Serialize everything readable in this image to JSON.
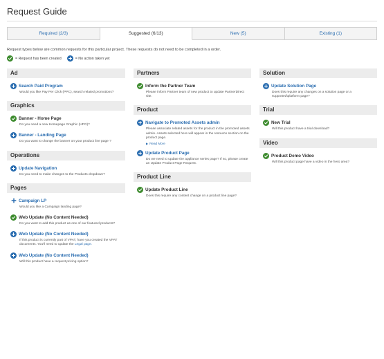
{
  "page": {
    "title": "Request Guide"
  },
  "tabs": [
    {
      "label": "Required (2/3)"
    },
    {
      "label": "Suggested (6/13)"
    },
    {
      "label": "New (5)"
    },
    {
      "label": "Existing (1)"
    }
  ],
  "intro": "Request types below are common requests for this particular project. These requests do not need to be completed in a order.",
  "legend": {
    "created": "= Request has been created",
    "no_action": "= No action taken yet"
  },
  "colors": {
    "link": "#2a6db0",
    "check": "#3d8b2e",
    "section_bg": "#ececec"
  },
  "columns": {
    "left": {
      "sections": [
        {
          "title": "Ad",
          "items": [
            {
              "title": "Search Paid Program",
              "desc": "Would you like Pay Per Click (PPC), search related promotions?",
              "icon": "plus-circle-icon"
            }
          ]
        },
        {
          "title": "Graphics",
          "items": [
            {
              "title": "Banner - Home Page",
              "desc": "Do you need a new Homepage Graphic (HPG)?",
              "icon": "check-circle-icon"
            },
            {
              "title": "Banner - Landing Page",
              "desc": "Do you want to change the banner on your product line page ?",
              "icon": "plus-circle-icon"
            }
          ]
        },
        {
          "title": "Operations",
          "items": [
            {
              "title": "Update Navigation",
              "desc": "Do you need to make changes to the Products dropdown?",
              "icon": "plus-circle-icon"
            }
          ]
        },
        {
          "title": "Pages",
          "items": [
            {
              "title": "Campaign LP",
              "desc": "Would you like a Campaign landing page?",
              "icon": "plus-icon"
            },
            {
              "title": "Web Update (No Content Needed)",
              "desc": "Do you want to add this product as one of our featured products?",
              "icon": "check-circle-icon"
            },
            {
              "title": "Web Update (No Content Needed)",
              "desc": "If this product is currently part of VPAT, have you created the VPAT documents. You'll need to update the ",
              "desc_link": "Legal page.",
              "icon": "plus-circle-icon"
            },
            {
              "title": "Web Update (No Content Needed)",
              "desc": "Will this product have a request pricing option?",
              "icon": "plus-circle-icon"
            }
          ]
        }
      ]
    },
    "middle": {
      "sections": [
        {
          "title": "Partners",
          "items": [
            {
              "title": "Inform the Partner Team",
              "desc": "Please inform Partner team of new product to update PartnerDirect site.",
              "icon": "check-circle-icon"
            }
          ]
        },
        {
          "title": "Product",
          "items": [
            {
              "title": "Navigate to Promoted Assets admin",
              "desc": "Please associate related assets for the product in the promoted assets admin. Assets selected here will appear in the resource section on the product page.",
              "read_more": "Read More",
              "icon": "plus-circle-icon"
            },
            {
              "title": "Update Product Page",
              "desc": "Do we need to update the appliance series page? If so, please create an Update Product Page Request.",
              "icon": "plus-circle-icon"
            }
          ]
        },
        {
          "title": "Product Line",
          "items": [
            {
              "title": "Update Product Line",
              "desc": "Does this require any content change on a product line page?",
              "icon": "check-circle-icon"
            }
          ]
        }
      ]
    },
    "right": {
      "sections": [
        {
          "title": "Solution",
          "items": [
            {
              "title": "Update Solution Page",
              "desc": "Does this require any changes on a solution page or a supported\\platform page?",
              "icon": "plus-circle-icon"
            }
          ]
        },
        {
          "title": "Trial",
          "items": [
            {
              "title": "New Trial",
              "desc": "Will this product have a trial download?",
              "icon": "check-circle-icon"
            }
          ]
        },
        {
          "title": "Video",
          "items": [
            {
              "title": "Product Demo Video",
              "desc": "Will this product page have a video in the hero area?",
              "icon": "check-circle-icon"
            }
          ]
        }
      ]
    }
  }
}
